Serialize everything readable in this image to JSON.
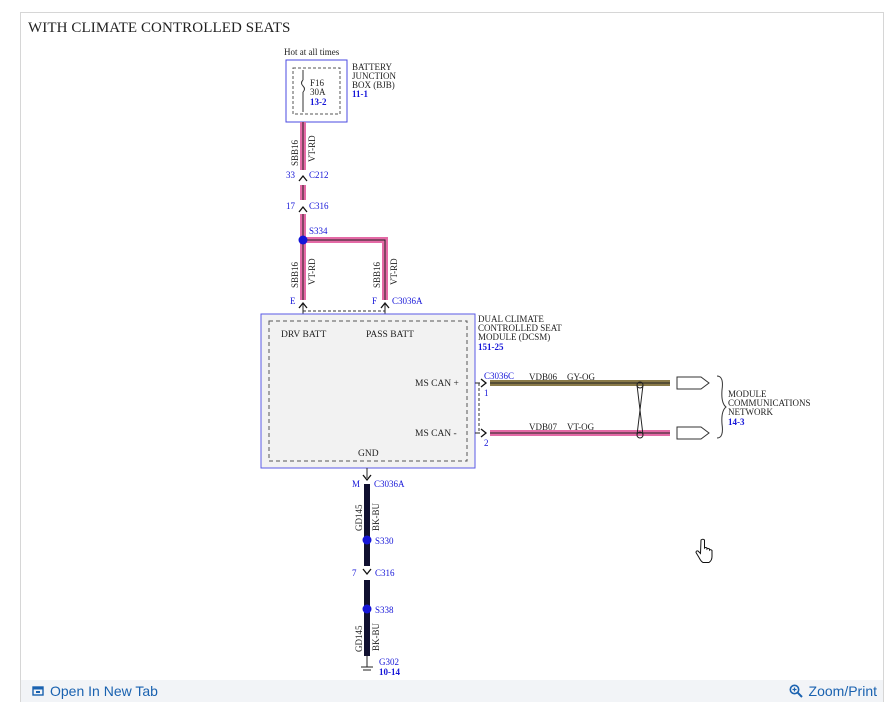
{
  "title": "WITH CLIMATE CONTROLLED SEATS",
  "hot_label": "Hot at all times",
  "fuse": {
    "name": "F16",
    "rating": "30A",
    "ref": "13-2"
  },
  "bjb": {
    "line1": "BATTERY",
    "line2": "JUNCTION",
    "line3": "BOX (BJB)",
    "ref": "11-1"
  },
  "wires": {
    "sbb16": "SBB16",
    "vtrd": "VT-RD",
    "gd145": "GD145",
    "bkbu": "BK-BU",
    "vdb06": "VDB06",
    "gyog": "GY-OG",
    "vdb07": "VDB07",
    "vtog": "VT-OG"
  },
  "connectors": {
    "c212_pin": "33",
    "c212": "C212",
    "c316_pin_top": "17",
    "c316": "C316",
    "s334": "S334",
    "pin_e": "E",
    "pin_f": "F",
    "c3036a": "C3036A",
    "c3036c": "C3036C",
    "pin_1": "1",
    "pin_2": "2",
    "pin_m": "M",
    "s330": "S330",
    "c316_pin_bottom": "7",
    "s338": "S338",
    "g302": "G302",
    "g302_ref": "10-14"
  },
  "module": {
    "line1": "DUAL CLIMATE",
    "line2": "CONTROLLED SEAT",
    "line3": "MODULE (DCSM)",
    "ref": "151-25",
    "drv_batt": "DRV BATT",
    "pass_batt": "PASS BATT",
    "ms_can_plus": "MS CAN +",
    "ms_can_minus": "MS CAN -",
    "gnd": "GND"
  },
  "network": {
    "line1": "MODULE",
    "line2": "COMMUNICATIONS",
    "line3": "NETWORK",
    "ref": "14-3"
  },
  "footer": {
    "open_new_tab": "Open In New Tab",
    "zoom_print": "Zoom/Print"
  },
  "colors": {
    "ref_blue": "#1515d8",
    "box_blue": "#4a4ae0",
    "wire_pink": "#e46aa6",
    "wire_black": "#101030",
    "wire_gyog": "#8a7a48",
    "link": "#1a62b0"
  }
}
